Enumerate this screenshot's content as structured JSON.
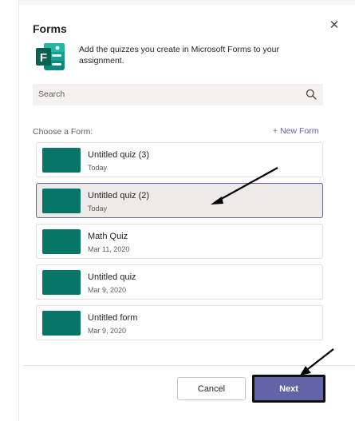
{
  "dialog": {
    "title": "Forms",
    "description": "Add the quizzes you create in Microsoft Forms to your assignment.",
    "logo_letter": "F",
    "close_icon": "close-icon"
  },
  "search": {
    "placeholder": "Search",
    "icon": "search-icon"
  },
  "list": {
    "label": "Choose a Form:",
    "new_form_label": "+ New Form",
    "items": [
      {
        "name": "Untitled quiz (3)",
        "date": "Today",
        "selected": false
      },
      {
        "name": "Untitled quiz (2)",
        "date": "Today",
        "selected": true
      },
      {
        "name": "Math Quiz",
        "date": "Mar 11, 2020",
        "selected": false
      },
      {
        "name": "Untitled quiz",
        "date": "Mar 9, 2020",
        "selected": false
      },
      {
        "name": "Untitled form",
        "date": "Mar 9, 2020",
        "selected": false
      }
    ]
  },
  "footer": {
    "cancel_label": "Cancel",
    "next_label": "Next"
  },
  "colors": {
    "accent": "#6264a7",
    "thumbnail": "#077568",
    "forms_brand": "#077568"
  }
}
